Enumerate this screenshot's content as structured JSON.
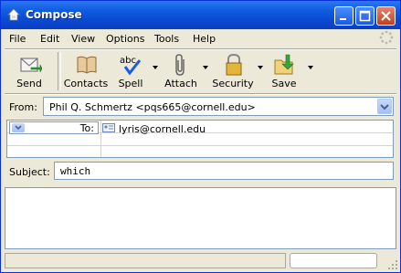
{
  "window": {
    "title": "Compose",
    "minimize_label": "_",
    "maximize_label": "□",
    "close_label": "×"
  },
  "menu": {
    "file": "File",
    "edit": "Edit",
    "view": "View",
    "options": "Options",
    "tools": "Tools",
    "help": "Help"
  },
  "toolbar": {
    "send": "Send",
    "contacts": "Contacts",
    "spell": "Spell",
    "attach": "Attach",
    "security": "Security",
    "save": "Save"
  },
  "header": {
    "from_label": "From:",
    "from_value": "Phil Q. Schmertz <pqs665@cornell.edu>",
    "to_type": "To:",
    "to_value": "lyris@cornell.edu",
    "subject_label": "Subject:",
    "subject_value": "which"
  },
  "colors": {
    "titlebar": "#0a4bd4",
    "window_bg": "#ece9d8",
    "field_border": "#7f9db9"
  }
}
